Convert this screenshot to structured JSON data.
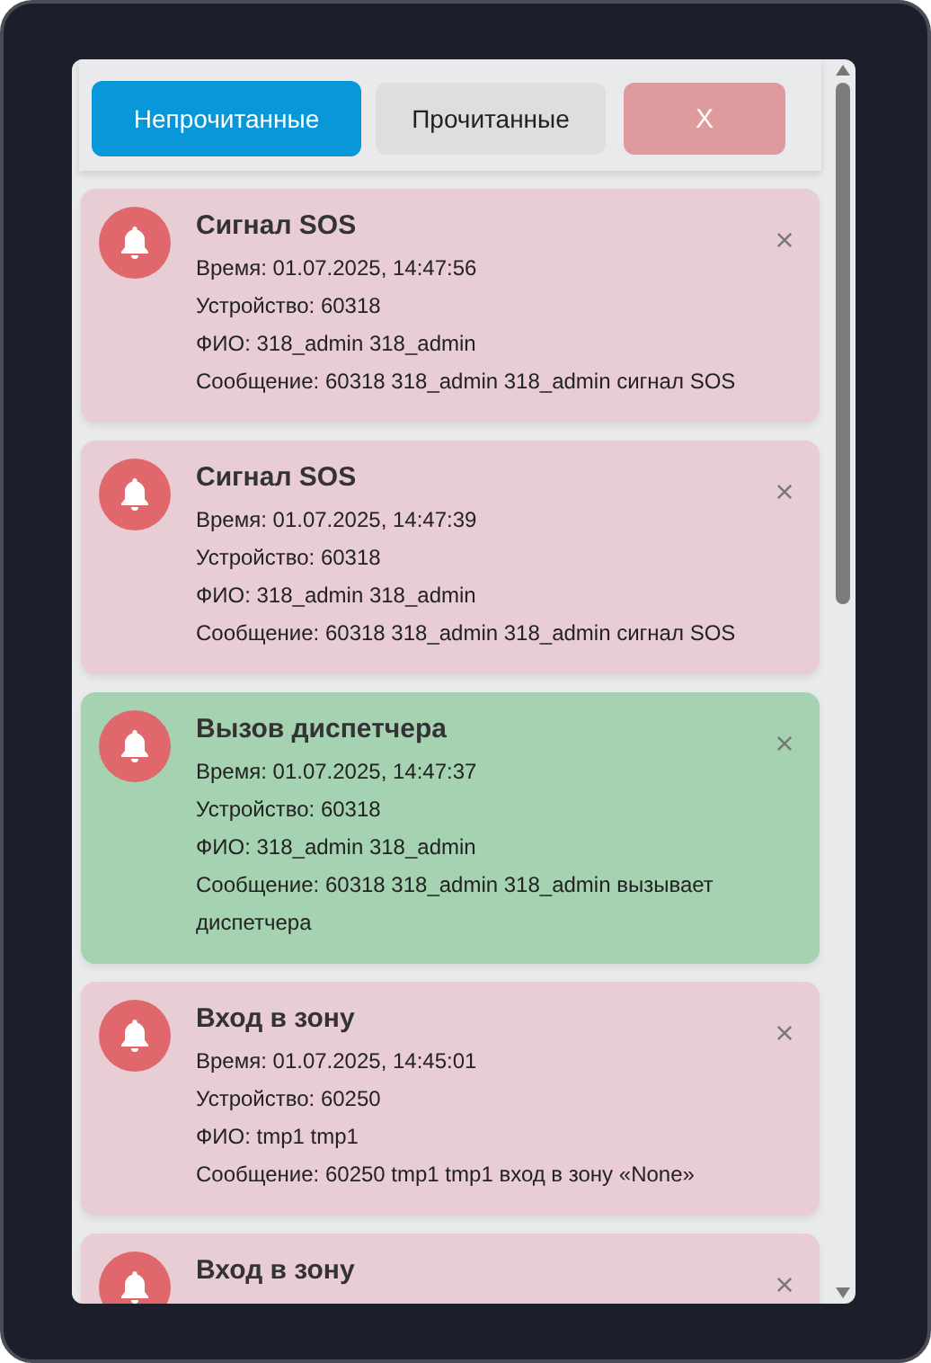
{
  "tabs": [
    {
      "label": "Непрочитанные",
      "selected": true
    },
    {
      "label": "Прочитанные",
      "selected": false
    }
  ],
  "close_button": {
    "label": "X"
  },
  "notifications": [
    {
      "title": "Сигнал SOS",
      "color": "#e8cdd5",
      "lines": [
        "Время: 01.07.2025, 14:47:56",
        "Устройство: 60318",
        "ФИО: 318_admin 318_admin",
        "Сообщение: 60318 318_admin 318_admin сигнал SOS"
      ]
    },
    {
      "title": "Сигнал SOS",
      "color": "#e8cdd5",
      "lines": [
        "Время: 01.07.2025, 14:47:39",
        "Устройство: 60318",
        "ФИО: 318_admin 318_admin",
        "Сообщение: 60318 318_admin 318_admin сигнал SOS"
      ]
    },
    {
      "title": "Вызов диспетчера",
      "color": "#a5d2b0",
      "lines": [
        "Время: 01.07.2025, 14:47:37",
        "Устройство: 60318",
        "ФИО: 318_admin 318_admin",
        "Сообщение: 60318 318_admin 318_admin вызывает диспетчера"
      ]
    },
    {
      "title": "Вход в зону",
      "color": "#e8cdd5",
      "lines": [
        "Время: 01.07.2025, 14:45:01",
        "Устройство: 60250",
        "ФИО: tmp1 tmp1",
        "Сообщение: 60250 tmp1 tmp1 вход в зону «None»"
      ]
    },
    {
      "title": "Вход в зону",
      "color": "#e8cdd5"
    }
  ]
}
